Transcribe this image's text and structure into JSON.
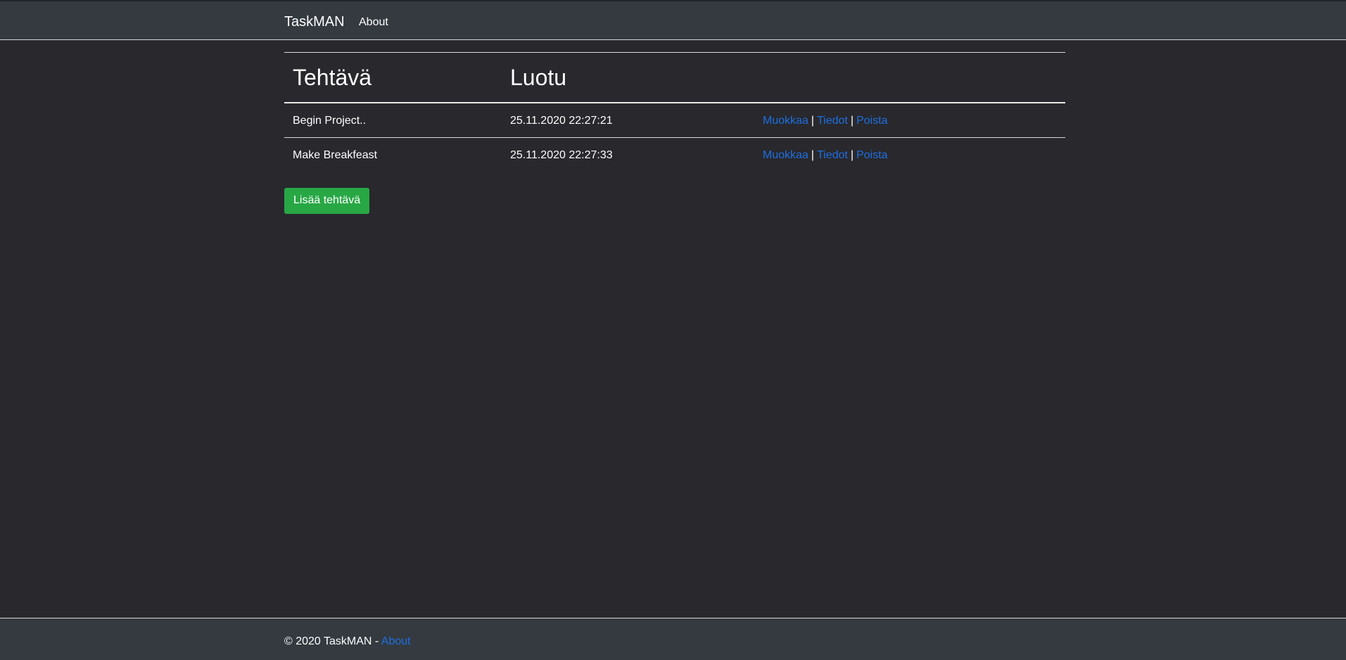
{
  "navbar": {
    "brand": "TaskMAN",
    "links": [
      {
        "label": "About"
      }
    ]
  },
  "table": {
    "headers": [
      "Tehtävä",
      "Luotu",
      ""
    ],
    "rows": [
      {
        "task": "Begin Project..",
        "created": "25.11.2020 22:27:21",
        "actions": {
          "edit": "Muokkaa",
          "details": "Tiedot",
          "delete": "Poista",
          "separator": "|"
        }
      },
      {
        "task": "Make Breakfeast",
        "created": "25.11.2020 22:27:33",
        "actions": {
          "edit": "Muokkaa",
          "details": "Tiedot",
          "delete": "Poista",
          "separator": "|"
        }
      }
    ]
  },
  "add_button": {
    "label": "Lisää tehtävä"
  },
  "footer": {
    "copyright": "© 2020 TaskMAN - ",
    "link": "About"
  },
  "colors": {
    "background": "#28282d",
    "navbar": "#343a40",
    "link": "#1f6fe0",
    "success": "#28a745"
  }
}
